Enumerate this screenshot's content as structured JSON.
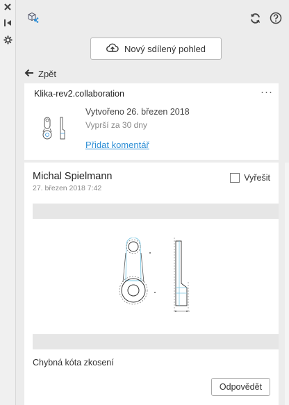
{
  "strip": {
    "icons": [
      "close-icon",
      "collapse-panel-icon",
      "settings-icon"
    ]
  },
  "toolbar": {
    "left_icon": "cube-share-icon",
    "refresh_icon": "refresh-icon",
    "help_icon": "help-icon"
  },
  "new_view_button": {
    "label": "Nový sdílený pohled",
    "icon": "cloud-upload-icon"
  },
  "back": {
    "label": "Zpět",
    "icon": "arrow-left-icon"
  },
  "collaboration": {
    "title": "Klika-rev2.collaboration",
    "more_label": "···",
    "created": "Vytvořeno 26. březen 2018",
    "expires": "Vyprší za 30 dny",
    "add_comment": "Přidat komentář"
  },
  "comment": {
    "author": "Michal Spielmann",
    "date": "27. březen 2018 7:42",
    "resolve_label": "Vyřešit",
    "resolved": false,
    "text": "Chybná kóta zkosení",
    "reply_label": "Odpovědět"
  },
  "colors": {
    "panel_bg": "#ececec",
    "link": "#2e8fd6",
    "drawing_cyan": "#7ec8e3"
  }
}
